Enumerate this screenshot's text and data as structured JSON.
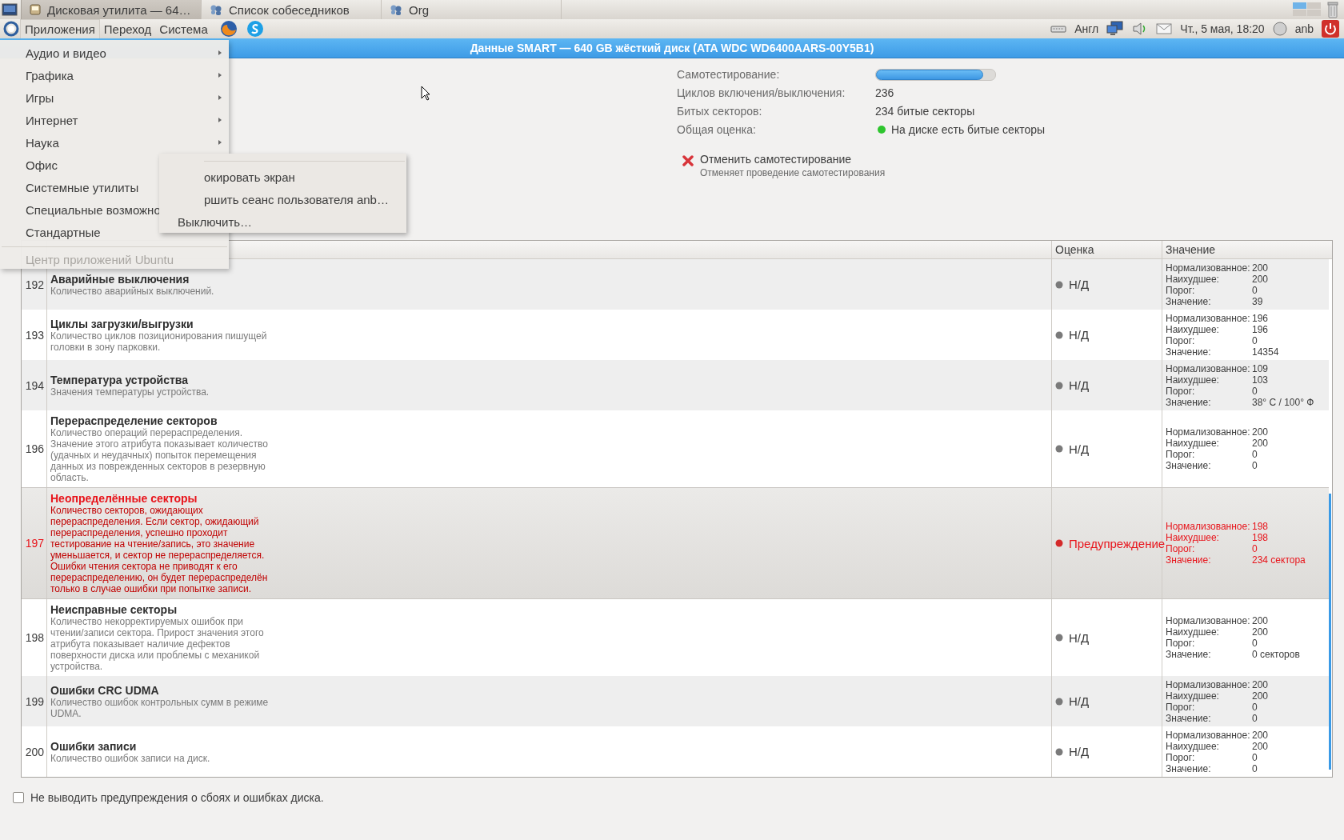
{
  "top_panel": {
    "tabs": [
      {
        "label": "Дисковая утилита — 64…",
        "selected": true
      },
      {
        "label": "Список собеседников",
        "selected": false
      },
      {
        "label": "Org",
        "selected": false
      }
    ]
  },
  "menu_bar": {
    "menus": [
      {
        "label": "Приложения",
        "selected": true
      },
      {
        "label": "Переход",
        "selected": false
      },
      {
        "label": "Система",
        "selected": false
      }
    ],
    "tray": {
      "keyboard_layout": "Англ",
      "clock": "Чт., 5 мая, 18:20",
      "user": "anb"
    }
  },
  "window": {
    "title": "Данные SMART — 640 GB жёсткий диск (ATA WDC WD6400AARS-00Y5B1)"
  },
  "summary": [
    {
      "kind": "progress",
      "label": "Самотестирование:",
      "level": 0.9
    },
    {
      "kind": "text",
      "label": "Циклов включения/выключения:",
      "value": "236"
    },
    {
      "kind": "text",
      "label": "Битых секторов:",
      "value": "234 битые секторы"
    },
    {
      "kind": "status",
      "label": "Общая оценка:",
      "value": "На диске есть битые секторы"
    }
  ],
  "action": {
    "title": "Отменить самотестирование",
    "description": "Отменяет проведение самотестирования"
  },
  "table": {
    "columns": [
      "Оценка",
      "Значение"
    ],
    "rows": [
      {
        "id": "192",
        "name": "Аварийные выключения",
        "description": "Количество аварийных выключений.",
        "assessment": "Н/Д",
        "warning": false,
        "selected": false,
        "values": [
          {
            "label": "Нормализованное:",
            "value": "200"
          },
          {
            "label": "Наихудшее:",
            "value": "200"
          },
          {
            "label": "Порог:",
            "value": "0"
          },
          {
            "label": "Значение:",
            "value": "39"
          }
        ]
      },
      {
        "id": "193",
        "name": "Циклы загрузки/выгрузки",
        "description": "Количество циклов позиционирования пишущей головки в зону парковки.",
        "assessment": "Н/Д",
        "warning": false,
        "selected": false,
        "values": [
          {
            "label": "Нормализованное:",
            "value": "196"
          },
          {
            "label": "Наихудшее:",
            "value": "196"
          },
          {
            "label": "Порог:",
            "value": "0"
          },
          {
            "label": "Значение:",
            "value": "14354"
          }
        ]
      },
      {
        "id": "194",
        "name": "Температура устройства",
        "description": "Значения температуры устройства.",
        "assessment": "Н/Д",
        "warning": false,
        "selected": false,
        "values": [
          {
            "label": "Нормализованное:",
            "value": "109"
          },
          {
            "label": "Наихудшее:",
            "value": "103"
          },
          {
            "label": "Порог:",
            "value": "0"
          },
          {
            "label": "Значение:",
            "value": "38° C / 100° Ф"
          }
        ]
      },
      {
        "id": "196",
        "name": "Перераспределение секторов",
        "description": "Количество операций перераспределения. Значение этого атрибута показывает количество (удачных и неудачных) попыток перемещения данных из поврежденных секторов в резервную область.",
        "assessment": "Н/Д",
        "warning": false,
        "selected": false,
        "values": [
          {
            "label": "Нормализованное:",
            "value": "200"
          },
          {
            "label": "Наихудшее:",
            "value": "200"
          },
          {
            "label": "Порог:",
            "value": "0"
          },
          {
            "label": "Значение:",
            "value": "0"
          }
        ]
      },
      {
        "id": "197",
        "name": "Неопределённые секторы",
        "description": "Количество секторов, ожидающих перераспределения. Если сектор, ожидающий перераспределения, успешно проходит тестирование на чтение/запись, это значение уменьшается, и сектор не перераспределяется. Ошибки чтения сектора не приводят к его перераспределению, он будет перераспределён только в случае ошибки при попытке записи.",
        "assessment": "Предупреждение",
        "warning": true,
        "selected": true,
        "values": [
          {
            "label": "Нормализованное:",
            "value": "198"
          },
          {
            "label": "Наихудшее:",
            "value": "198"
          },
          {
            "label": "Порог:",
            "value": "0"
          },
          {
            "label": "Значение:",
            "value": "234 сектора"
          }
        ]
      },
      {
        "id": "198",
        "name": "Неисправные секторы",
        "description": "Количество некорректируемых ошибок при чтении/записи сектора. Прирост значения этого атрибута показывает наличие дефектов поверхности диска или проблемы с механикой устройства.",
        "assessment": "Н/Д",
        "warning": false,
        "selected": false,
        "values": [
          {
            "label": "Нормализованное:",
            "value": "200"
          },
          {
            "label": "Наихудшее:",
            "value": "200"
          },
          {
            "label": "Порог:",
            "value": "0"
          },
          {
            "label": "Значение:",
            "value": "0 секторов"
          }
        ]
      },
      {
        "id": "199",
        "name": "Ошибки CRC UDMA",
        "description": "Количество ошибок контрольных сумм в режиме UDMA.",
        "assessment": "Н/Д",
        "warning": false,
        "selected": false,
        "values": [
          {
            "label": "Нормализованное:",
            "value": "200"
          },
          {
            "label": "Наихудшее:",
            "value": "200"
          },
          {
            "label": "Порог:",
            "value": "0"
          },
          {
            "label": "Значение:",
            "value": "0"
          }
        ]
      },
      {
        "id": "200",
        "name": "Ошибки записи",
        "description": "Количество ошибок записи на диск.",
        "assessment": "Н/Д",
        "warning": false,
        "selected": false,
        "values": [
          {
            "label": "Нормализованное:",
            "value": "200"
          },
          {
            "label": "Наихудшее:",
            "value": "200"
          },
          {
            "label": "Порог:",
            "value": "0"
          },
          {
            "label": "Значение:",
            "value": "0"
          }
        ]
      }
    ]
  },
  "option": {
    "label": "Не выводить предупреждения о сбоях и ошибках диска.",
    "checked": false
  },
  "apps_menu": {
    "items": [
      {
        "label": "Аудио и видео",
        "submenu": true,
        "disabled": false
      },
      {
        "label": "Графика",
        "submenu": true,
        "disabled": false
      },
      {
        "label": "Игры",
        "submenu": true,
        "disabled": false
      },
      {
        "label": "Интернет",
        "submenu": true,
        "disabled": false
      },
      {
        "label": "Наука",
        "submenu": true,
        "disabled": false
      },
      {
        "label": "Офис",
        "submenu": false,
        "disabled": false
      },
      {
        "label": "Системные утилиты",
        "submenu": false,
        "disabled": false
      },
      {
        "label": "Специальные возможно",
        "submenu": false,
        "disabled": false
      },
      {
        "label": "Стандартные",
        "submenu": false,
        "disabled": false
      },
      {
        "label": "Центр приложений Ubuntu",
        "submenu": false,
        "disabled": true
      }
    ]
  },
  "system_submenu": {
    "items": [
      "окировать экран",
      "ршить сеанс пользователя anb…",
      "Выключить…"
    ]
  }
}
